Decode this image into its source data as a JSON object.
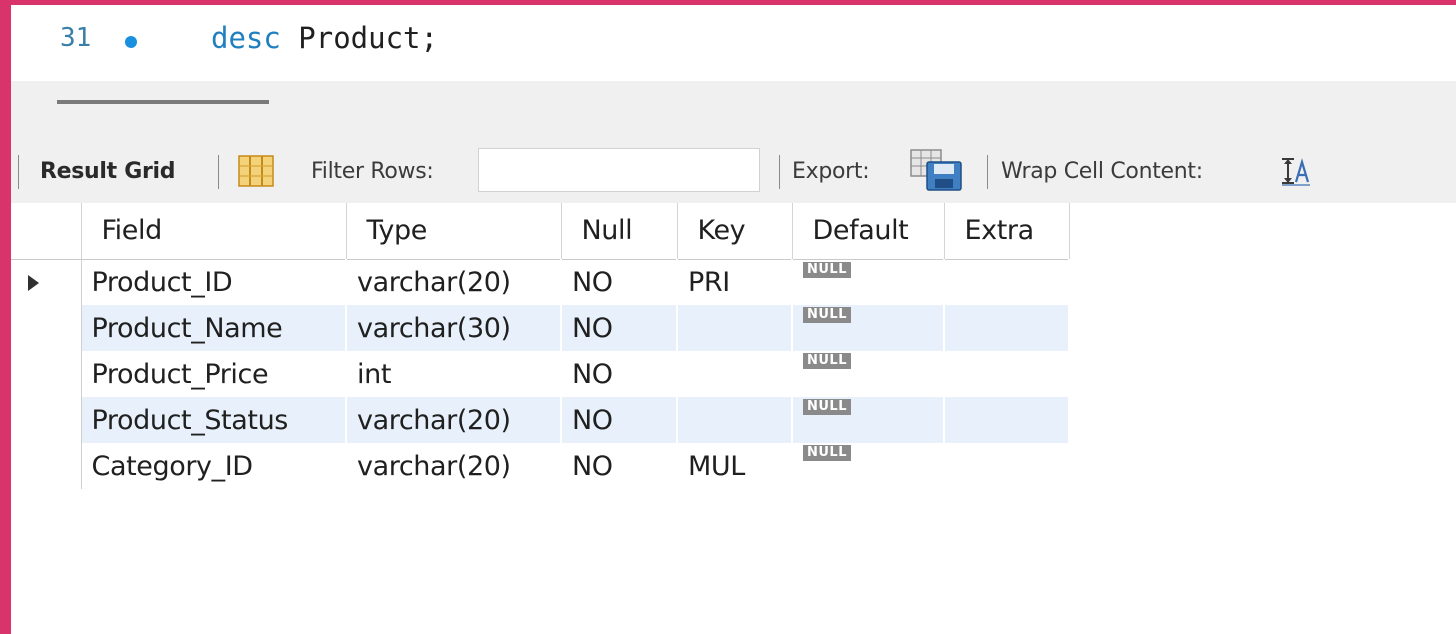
{
  "editor": {
    "line_number": "31",
    "keyword": "desc",
    "rest": " Product;"
  },
  "toolbar": {
    "result_grid_label": "Result Grid",
    "filter_label": "Filter Rows:",
    "filter_value": "",
    "export_label": "Export:",
    "wrap_label": "Wrap Cell Content:"
  },
  "icons": {
    "grid_view": "grid-view-icon",
    "export": "export-icon",
    "wrap": "wrap-cell-icon"
  },
  "grid": {
    "columns": [
      "Field",
      "Type",
      "Null",
      "Key",
      "Default",
      "Extra"
    ],
    "rows": [
      {
        "field": "Product_ID",
        "type": "varchar(20)",
        "null": "NO",
        "key": "PRI",
        "default": "NULL",
        "extra": ""
      },
      {
        "field": "Product_Name",
        "type": "varchar(30)",
        "null": "NO",
        "key": "",
        "default": "NULL",
        "extra": ""
      },
      {
        "field": "Product_Price",
        "type": "int",
        "null": "NO",
        "key": "",
        "default": "NULL",
        "extra": ""
      },
      {
        "field": "Product_Status",
        "type": "varchar(20)",
        "null": "NO",
        "key": "",
        "default": "NULL",
        "extra": ""
      },
      {
        "field": "Category_ID",
        "type": "varchar(20)",
        "null": "NO",
        "key": "MUL",
        "default": "NULL",
        "extra": ""
      }
    ]
  },
  "colors": {
    "frame_border": "#d8336b",
    "keyword": "#1f7fbf",
    "alt_row": "#e8f1fb",
    "null_badge": "#8a8a8a"
  }
}
